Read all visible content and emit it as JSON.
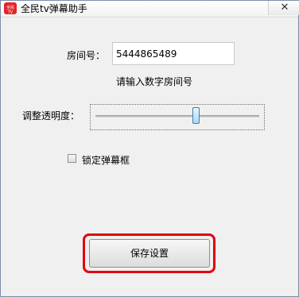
{
  "window": {
    "title": "全民tv弹幕助手",
    "icon_name": "quanmin-tv-app-icon",
    "icon_text": "全民TV",
    "close_symbol": "✕"
  },
  "form": {
    "room_label": "房间号：",
    "room_value": "5444865489",
    "room_hint": "请输入数字房间号",
    "opacity_label": "调整透明度：",
    "opacity_level": 0.62,
    "lock_label": "锁定弹幕框",
    "lock_checked": false,
    "save_label": "保存设置"
  },
  "colors": {
    "highlight": "#e1000e",
    "app_icon": "#e3242b",
    "slider_thumb": "#a7d9f5"
  }
}
